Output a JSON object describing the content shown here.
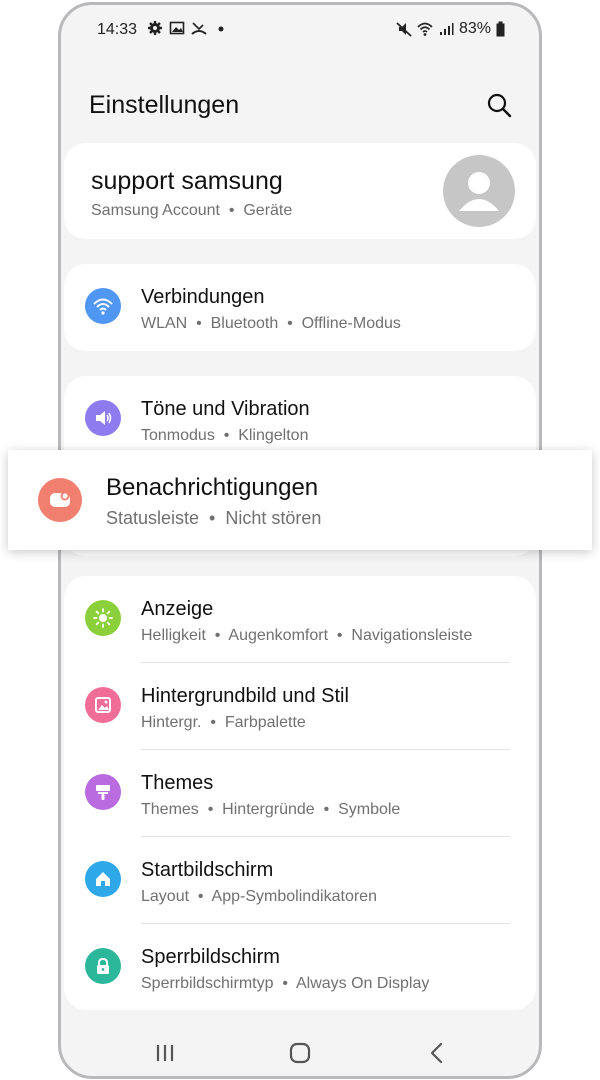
{
  "status_bar": {
    "time": "14:33",
    "left_icons": [
      "gear-icon",
      "image-icon",
      "missed-call-icon",
      "dot-icon"
    ],
    "right_icons": [
      "mute-icon",
      "wifi-icon",
      "signal-icon"
    ],
    "battery_text": "83%"
  },
  "header": {
    "title": "Einstellungen"
  },
  "account": {
    "name": "support samsung",
    "subtitle": "Samsung Account  •  Geräte"
  },
  "items": [
    {
      "title": "Verbindungen",
      "subtitle": "WLAN  •  Bluetooth  •  Offline-Modus",
      "icon": "wifi-icon",
      "color": "#4f97f2"
    },
    {
      "title": "Töne und Vibration",
      "subtitle": "Tonmodus  •  Klingelton",
      "icon": "speaker-icon",
      "color": "#8f7bf0"
    },
    {
      "title": "Anzeige",
      "subtitle": "Helligkeit  •  Augenkomfort  •  Navigationsleiste",
      "icon": "sun-icon",
      "color": "#8bd03b"
    },
    {
      "title": "Hintergrundbild und Stil",
      "subtitle": "Hintergr.  •  Farbpalette",
      "icon": "picture-icon",
      "color": "#ef6d96"
    },
    {
      "title": "Themes",
      "subtitle": "Themes  •  Hintergründe  •  Symbole",
      "icon": "brush-icon",
      "color": "#b96bdf"
    },
    {
      "title": "Startbildschirm",
      "subtitle": "Layout  •  App-Symbolindikatoren",
      "icon": "home-icon",
      "color": "#2ea8e8"
    },
    {
      "title": "Sperrbildschirm",
      "subtitle": "Sperrbildschirmtyp  •  Always On Display",
      "icon": "lock-icon",
      "color": "#2bb79a"
    }
  ],
  "highlighted": {
    "title": "Benachrichtigungen",
    "subtitle": "Statusleiste  •  Nicht stören",
    "icon": "notification-icon",
    "color": "#f07f6f"
  },
  "nav_bar": {
    "buttons": [
      "recents-icon",
      "home-button-icon",
      "back-icon"
    ]
  }
}
